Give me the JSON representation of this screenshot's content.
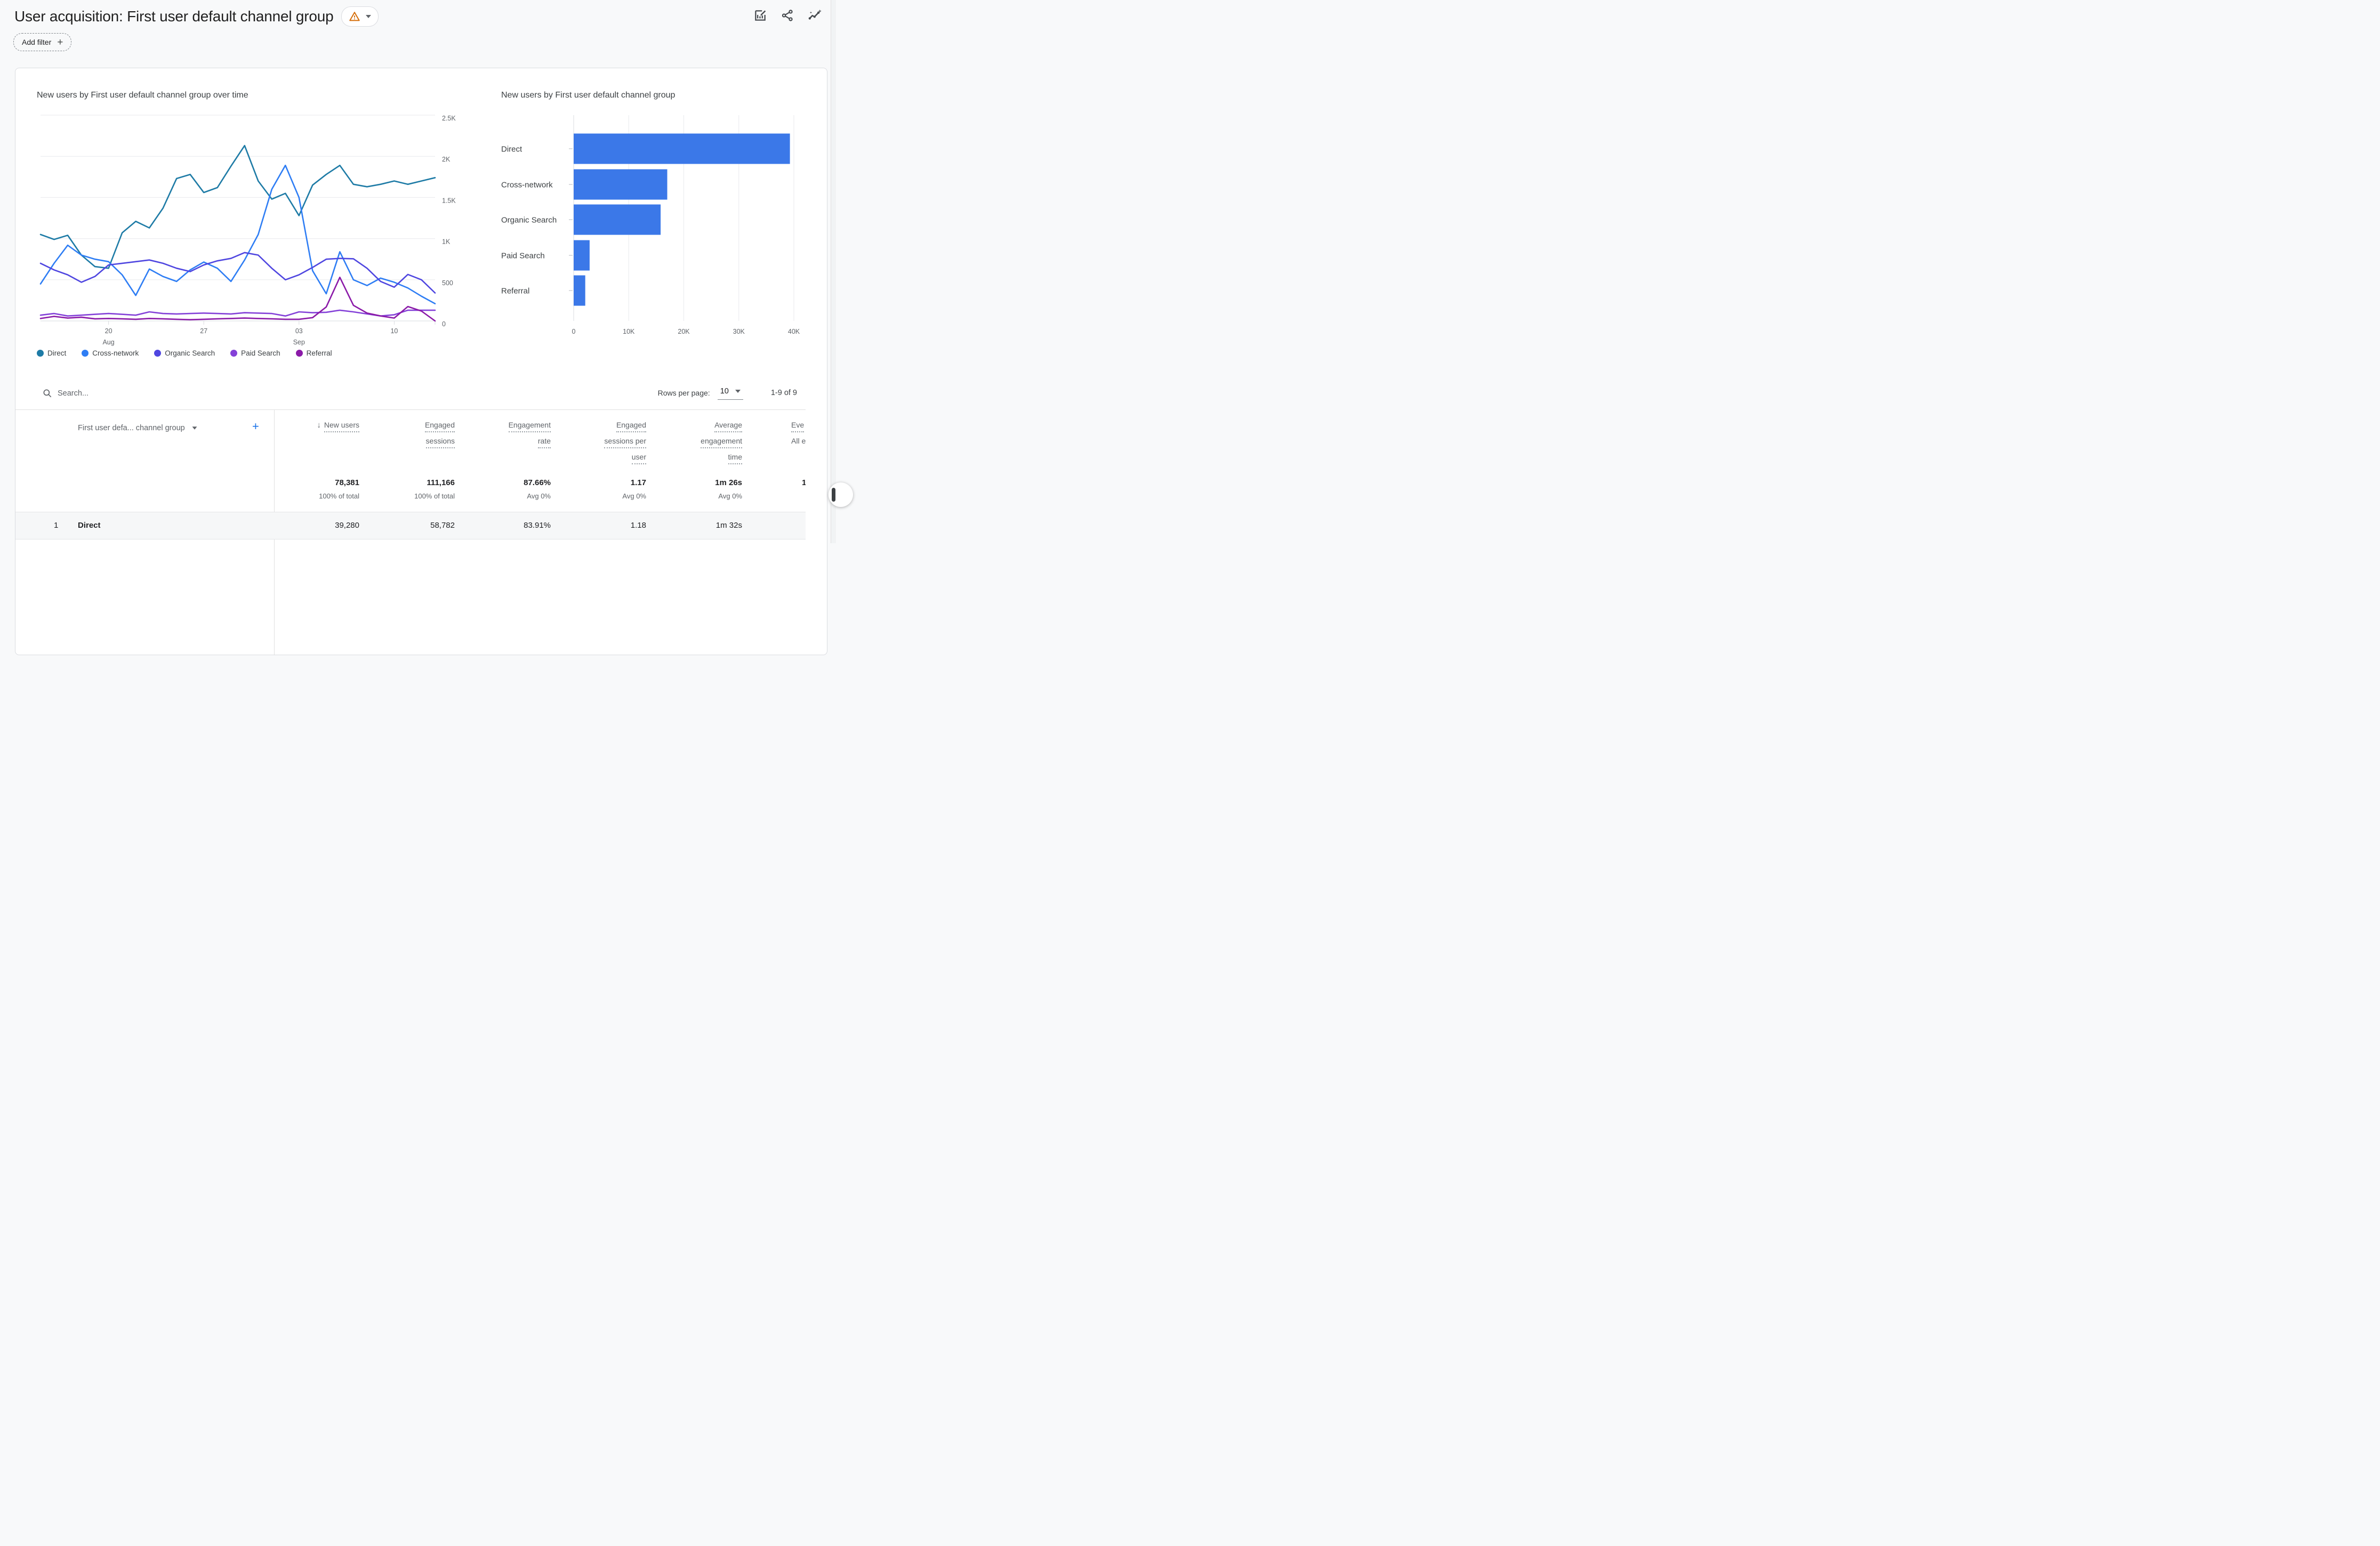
{
  "header": {
    "title": "User acquisition: First user default channel group",
    "add_filter_label": "Add filter",
    "warning_icon_color": "#d56e0a",
    "toolbar_icons": [
      "edit-report-icon",
      "share-icon",
      "insights-icon"
    ]
  },
  "chart_data": [
    {
      "type": "line",
      "title": "New users by First user default channel group over time",
      "ylabel": "New users",
      "ylim": [
        0,
        2500
      ],
      "y_ticks": [
        0,
        500,
        1000,
        1500,
        2000,
        2500
      ],
      "y_tick_labels": [
        "0",
        "500",
        "1K",
        "1.5K",
        "2K",
        "2.5K"
      ],
      "grid": "horizontal",
      "legend_position": "bottom",
      "x_ticks": [
        {
          "index": 5,
          "label": "20",
          "sublabel": "Aug"
        },
        {
          "index": 12,
          "label": "27",
          "sublabel": ""
        },
        {
          "index": 19,
          "label": "03",
          "sublabel": "Sep"
        },
        {
          "index": 26,
          "label": "10",
          "sublabel": ""
        }
      ],
      "series": [
        {
          "name": "Direct",
          "color": "#1e7ba6",
          "values": [
            1050,
            990,
            1040,
            800,
            660,
            640,
            1070,
            1210,
            1130,
            1370,
            1730,
            1780,
            1560,
            1620,
            1880,
            2130,
            1700,
            1480,
            1550,
            1280,
            1650,
            1780,
            1890,
            1660,
            1630,
            1660,
            1700,
            1660,
            1700,
            1740
          ]
        },
        {
          "name": "Cross-network",
          "color": "#2e7df4",
          "values": [
            450,
            700,
            920,
            800,
            750,
            720,
            560,
            310,
            630,
            540,
            480,
            620,
            715,
            640,
            480,
            740,
            1050,
            1600,
            1890,
            1500,
            610,
            330,
            840,
            500,
            430,
            520,
            470,
            400,
            300,
            210
          ]
        },
        {
          "name": "Organic Search",
          "color": "#4f46e0",
          "values": [
            700,
            620,
            560,
            470,
            540,
            680,
            700,
            720,
            740,
            700,
            640,
            600,
            680,
            730,
            760,
            830,
            800,
            640,
            500,
            560,
            650,
            750,
            760,
            755,
            640,
            480,
            410,
            565,
            500,
            340
          ]
        },
        {
          "name": "Paid Search",
          "color": "#8441d8",
          "values": [
            70,
            90,
            60,
            70,
            80,
            90,
            80,
            70,
            110,
            90,
            85,
            90,
            95,
            90,
            85,
            100,
            95,
            90,
            60,
            110,
            100,
            105,
            130,
            110,
            85,
            60,
            75,
            130,
            130,
            130
          ]
        },
        {
          "name": "Referral",
          "color": "#8b1aa8",
          "values": [
            30,
            55,
            35,
            45,
            25,
            30,
            25,
            20,
            30,
            25,
            20,
            15,
            20,
            25,
            30,
            35,
            30,
            25,
            20,
            20,
            40,
            170,
            530,
            190,
            95,
            60,
            35,
            175,
            120,
            0
          ]
        }
      ]
    },
    {
      "type": "bar",
      "orientation": "horizontal",
      "title": "New users by First user default channel group",
      "categories": [
        "Direct",
        "Cross-network",
        "Organic Search",
        "Paid Search",
        "Referral"
      ],
      "values": [
        39280,
        17000,
        15800,
        2900,
        2100
      ],
      "bar_color": "#3b78e8",
      "xlim": [
        0,
        40000
      ],
      "x_ticks": [
        0,
        10000,
        20000,
        30000,
        40000
      ],
      "x_tick_labels": [
        "0",
        "10K",
        "20K",
        "30K",
        "40K"
      ],
      "grid": "vertical"
    }
  ],
  "table": {
    "search_placeholder": "Search...",
    "rows_per_page_label": "Rows per page:",
    "rows_per_page_value": "10",
    "range_label": "1-9 of 9",
    "dimension_header": "First user defa... channel group",
    "columns": [
      {
        "lines": [
          "New users"
        ],
        "sorted": true
      },
      {
        "lines": [
          "Engaged",
          "sessions"
        ]
      },
      {
        "lines": [
          "Engagement",
          "rate"
        ]
      },
      {
        "lines": [
          "Engaged",
          "sessions per",
          "user"
        ]
      },
      {
        "lines": [
          "Average",
          "engagement",
          "time"
        ]
      },
      {
        "lines": [
          "Eve",
          "All e"
        ],
        "truncated": true
      }
    ],
    "totals": {
      "values": [
        "78,381",
        "111,166",
        "87.66%",
        "1.17",
        "1m 26s",
        "1"
      ],
      "subtexts": [
        "100% of total",
        "100% of total",
        "Avg 0%",
        "Avg 0%",
        "Avg 0%",
        ""
      ]
    },
    "rows": [
      {
        "index": "1",
        "dimension": "Direct",
        "values": [
          "39,280",
          "58,782",
          "83.91%",
          "1.18",
          "1m 32s",
          ""
        ]
      }
    ]
  },
  "colors": {
    "accent_blue": "#1a73e8",
    "text_primary": "#202124",
    "text_secondary": "#5f6368",
    "gridline": "#e8eaed",
    "axis_line": "#dadce0",
    "divider": "#e0e0e0",
    "row_highlight": "#f6f7f8"
  }
}
